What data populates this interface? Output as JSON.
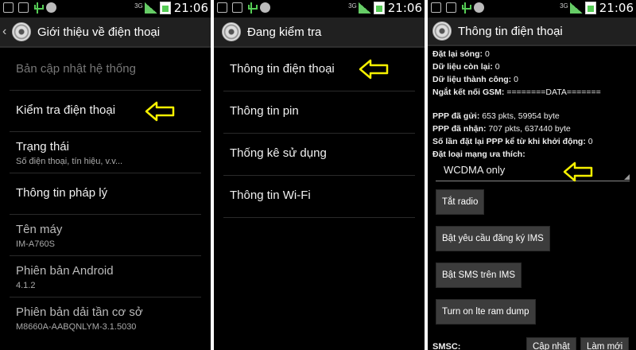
{
  "status": {
    "clock": "21:06",
    "network": "3G"
  },
  "panel1": {
    "title": "Giới thiệu về điện thoại",
    "items": [
      {
        "title": "Bản cập nhật hệ thống",
        "sub": ""
      },
      {
        "title": "Kiểm tra điện thoại",
        "sub": ""
      },
      {
        "title": "Trạng thái",
        "sub": "Số điện thoại, tín hiệu, v.v..."
      },
      {
        "title": "Thông tin pháp lý",
        "sub": ""
      },
      {
        "title": "Tên máy",
        "sub": "IM-A760S"
      },
      {
        "title": "Phiên bản Android",
        "sub": "4.1.2"
      },
      {
        "title": "Phiên bản dải tần cơ sở",
        "sub": "M8660A-AABQNLYM-3.1.5030"
      }
    ]
  },
  "panel2": {
    "title": "Đang kiểm tra",
    "items": [
      {
        "title": "Thông tin điện thoại"
      },
      {
        "title": "Thông tin pin"
      },
      {
        "title": "Thống kê sử dụng"
      },
      {
        "title": "Thông tin Wi-Fi"
      }
    ]
  },
  "panel3": {
    "title": "Thông tin điện thoại",
    "lines": [
      {
        "label": "Đặt lại sóng:",
        "value": "0"
      },
      {
        "label": "Dữ liệu còn lại:",
        "value": "0"
      },
      {
        "label": "Dữ liệu thành công:",
        "value": "0"
      },
      {
        "label": "Ngắt kết nối GSM:",
        "value": "========DATA======="
      }
    ],
    "lines2": [
      {
        "label": "PPP đã gửi:",
        "value": "653 pkts, 59954 byte"
      },
      {
        "label": "PPP đã nhận:",
        "value": "707 pkts, 637440 byte"
      },
      {
        "label": "Số lần đặt lại PPP kể từ khi khởi động:",
        "value": "0"
      },
      {
        "label": "Đặt loại mạng ưa thích:",
        "value": ""
      }
    ],
    "spinner_value": "WCDMA only",
    "buttons": {
      "radio": "Tắt radio",
      "ims": "Bật yêu cầu đăng ký IMS",
      "sms": "Bật SMS trên IMS",
      "lte": "Turn on lte ram dump",
      "update": "Cập nhật",
      "refresh": "Làm mới"
    },
    "smsc_label": "SMSC:"
  },
  "colors": {
    "highlight_arrow": "#f5f000",
    "background": "#000000",
    "actionbar": "#202020"
  }
}
